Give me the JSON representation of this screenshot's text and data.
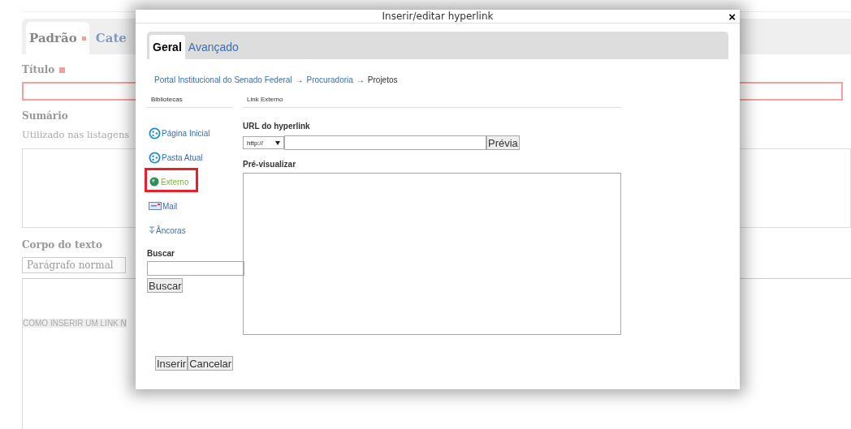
{
  "page": {
    "tabs": [
      {
        "label": "Padrão",
        "selected": true,
        "required": true
      },
      {
        "label": "Cate",
        "selected": false,
        "required": false
      }
    ],
    "title_label": "Título",
    "summary_label": "Sumário",
    "summary_hint": "Utilizado nas listagens",
    "body_label": "Corpo do texto",
    "paragraph_select": "Parágrafo normal",
    "body_text": "COMO INSERIR UM LINK N"
  },
  "dialog": {
    "title": "Inserir/editar hyperlink",
    "close": "×",
    "tabs": [
      {
        "label": "Geral",
        "selected": true
      },
      {
        "label": "Avançado",
        "selected": false
      }
    ],
    "breadcrumb": [
      {
        "label": "Portal Institucional do Senado Federal",
        "kind": "link"
      },
      {
        "label": "→",
        "kind": "sep"
      },
      {
        "label": "Procuradoria",
        "kind": "link"
      },
      {
        "label": "→",
        "kind": "sep"
      },
      {
        "label": "Projetos",
        "kind": "current"
      }
    ],
    "libraries_heading": "Bibliotecas",
    "libraries": [
      {
        "label": "Página Inicial",
        "kind": "site",
        "selected": false
      },
      {
        "label": "Pasta Atual",
        "kind": "site",
        "selected": false
      },
      {
        "label": "Externo",
        "kind": "globe",
        "selected": true
      },
      {
        "label": "Mail",
        "kind": "mail",
        "selected": false
      },
      {
        "label": "Âncoras",
        "kind": "anchor",
        "selected": false
      }
    ],
    "search_label": "Buscar",
    "search_button": "Buscar",
    "panel_heading": "Link Externo",
    "url_label": "URL do hyperlink",
    "protocol": "http://",
    "preview_button": "Prévia",
    "preview_label": "Pré-visualizar",
    "buttons": [
      "Inserir",
      "Cancelar"
    ]
  }
}
